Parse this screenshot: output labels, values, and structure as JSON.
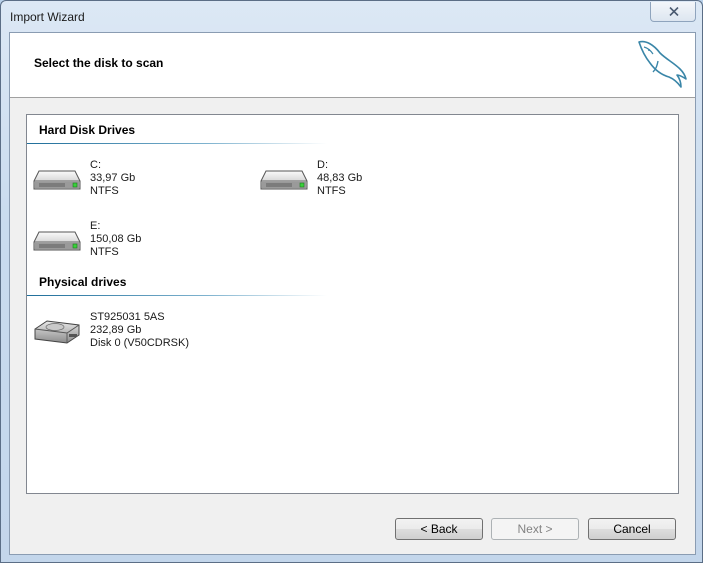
{
  "window": {
    "title": "Import Wizard"
  },
  "header": {
    "title": "Select the disk to scan",
    "logo": "dolphin-logo"
  },
  "hard_disk_drives": {
    "title": "Hard Disk Drives",
    "items": [
      {
        "name": "C:",
        "size": "33,97 Gb",
        "fs": "NTFS"
      },
      {
        "name": "D:",
        "size": "48,83 Gb",
        "fs": "NTFS"
      },
      {
        "name": "E:",
        "size": "150,08 Gb",
        "fs": "NTFS"
      }
    ]
  },
  "physical_drives": {
    "title": "Physical drives",
    "items": [
      {
        "name": "ST925031 5AS",
        "size": "232,89 Gb",
        "detail": "Disk 0 (V50CDRSK)"
      }
    ]
  },
  "buttons": {
    "back": "< Back",
    "next": "Next >",
    "cancel": "Cancel"
  }
}
